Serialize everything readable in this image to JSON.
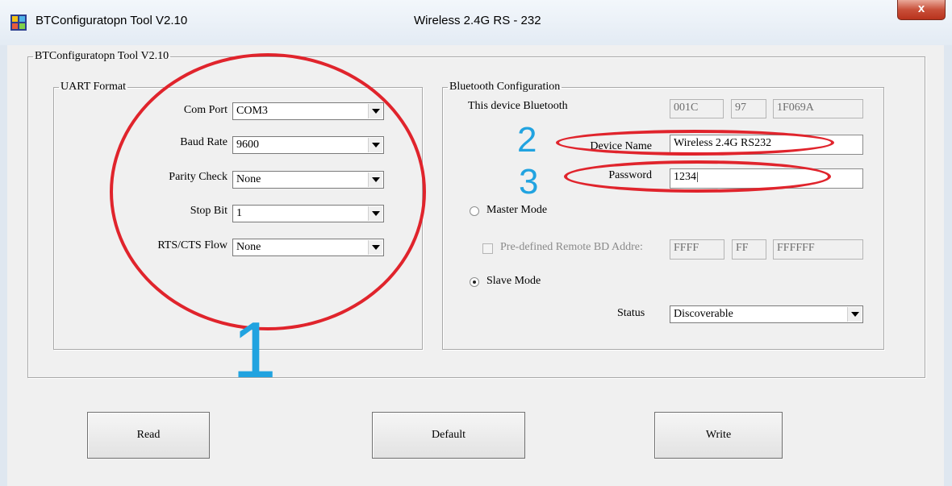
{
  "window": {
    "title": "BTConfiguratopn Tool V2.10",
    "title_right": "Wireless 2.4G RS - 232",
    "close_glyph": "x"
  },
  "main_group": {
    "legend": "BTConfiguratopn Tool V2.10"
  },
  "uart": {
    "legend": "UART Format",
    "fields": [
      {
        "label": "Com Port",
        "value": "COM3"
      },
      {
        "label": "Baud Rate",
        "value": "9600"
      },
      {
        "label": "Parity Check",
        "value": "None"
      },
      {
        "label": "Stop Bit",
        "value": "1"
      },
      {
        "label": "RTS/CTS Flow",
        "value": "None"
      }
    ]
  },
  "bluetooth": {
    "legend": "Bluetooth Configuration",
    "this_device_label": "This device Bluetooth",
    "address": [
      "001C",
      "97",
      "1F069A"
    ],
    "device_name_label": "Device Name",
    "device_name_value": "Wireless 2.4G RS232",
    "password_label": "Password",
    "password_value": "1234|",
    "master_mode_label": "Master Mode",
    "master_mode_selected": false,
    "predefined_label": "Pre-defined Remote BD Addre:",
    "predefined_address": [
      "FFFF",
      "FF",
      "FFFFFF"
    ],
    "slave_mode_label": "Slave Mode",
    "slave_mode_selected": true,
    "status_label": "Status",
    "status_value": "Discoverable"
  },
  "buttons": {
    "read": "Read",
    "default": "Default",
    "write": "Write"
  },
  "annotations": {
    "one": "1",
    "two": "2",
    "three": "3",
    "circle_color": "#e0242c",
    "number_color": "#21a3e0"
  }
}
